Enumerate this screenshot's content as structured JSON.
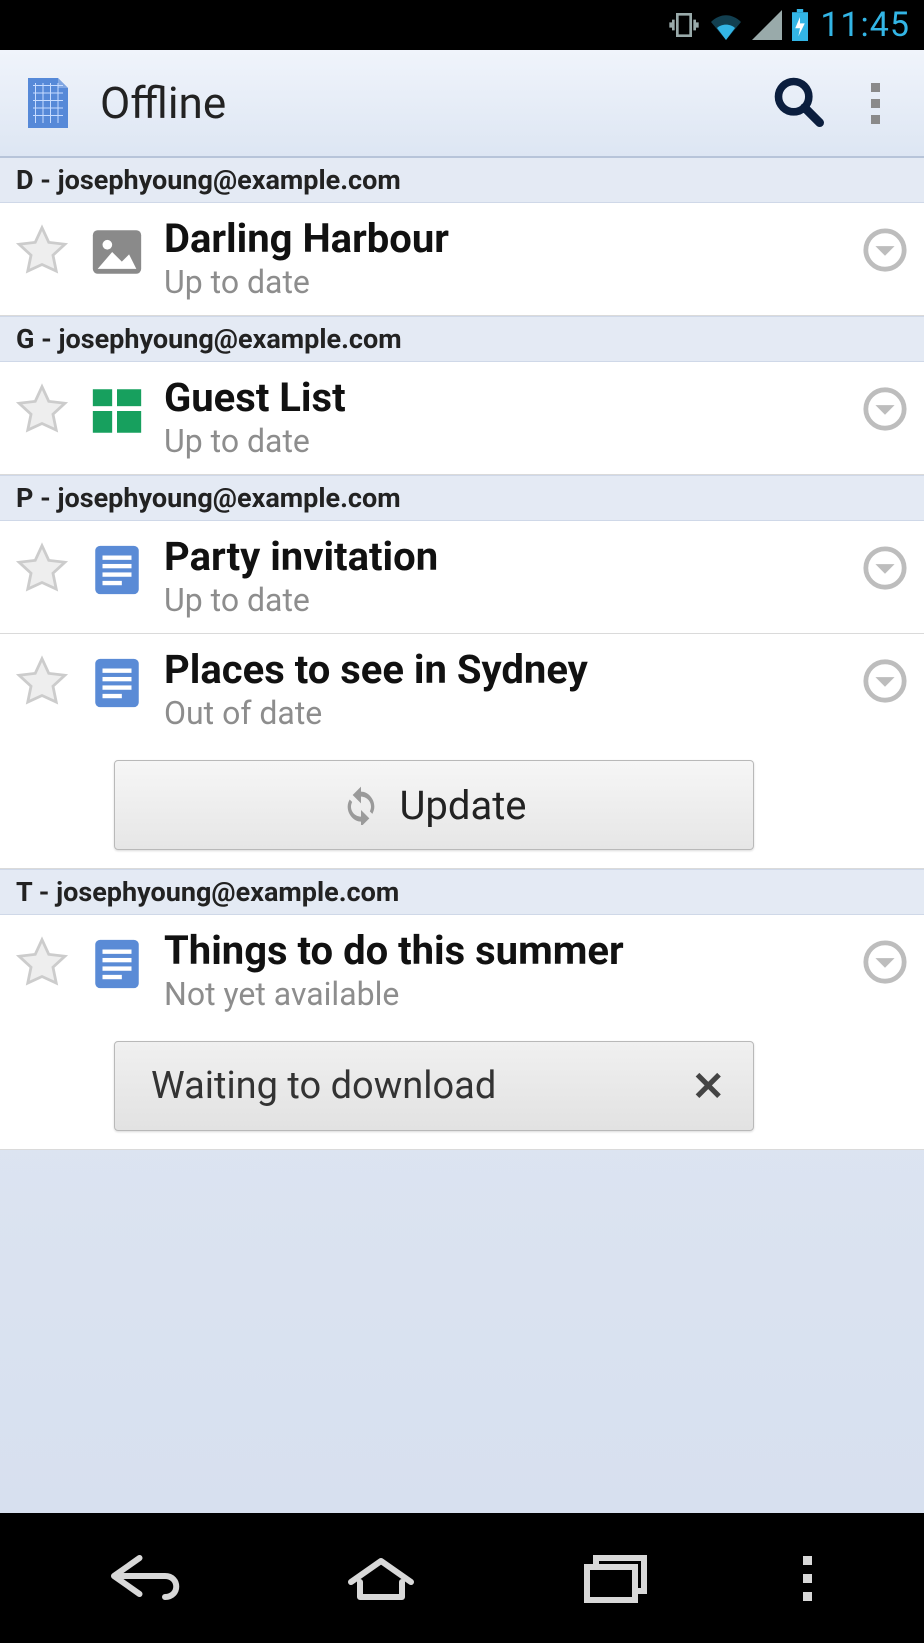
{
  "status": {
    "time": "11:45"
  },
  "actionbar": {
    "title": "Offline"
  },
  "sections": [
    {
      "header": "D - josephyoung@example.com",
      "items": [
        {
          "title": "Darling Harbour",
          "sub": "Up to date",
          "type": "image"
        }
      ]
    },
    {
      "header": "G - josephyoung@example.com",
      "items": [
        {
          "title": "Guest List",
          "sub": "Up to date",
          "type": "sheet"
        }
      ]
    },
    {
      "header": "P - josephyoung@example.com",
      "items": [
        {
          "title": "Party invitation",
          "sub": "Up to date",
          "type": "doc"
        },
        {
          "title": "Places to see in Sydney",
          "sub": "Out of date",
          "type": "doc",
          "action": "update",
          "action_label": "Update"
        }
      ]
    },
    {
      "header": "T - josephyoung@example.com",
      "items": [
        {
          "title": "Things to do this summer",
          "sub": "Not yet available",
          "type": "doc",
          "action": "waiting",
          "action_label": "Waiting to download"
        }
      ]
    }
  ]
}
